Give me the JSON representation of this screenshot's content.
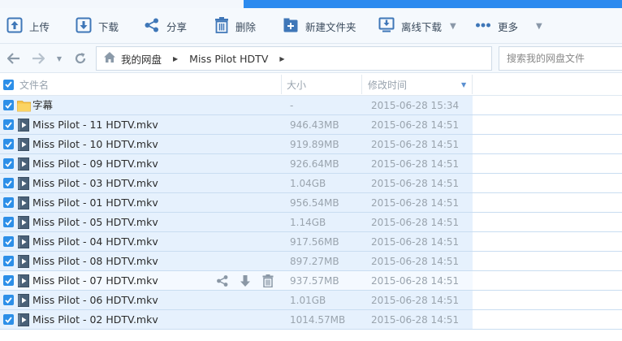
{
  "toolbar": {
    "upload": "上传",
    "download": "下载",
    "share": "分享",
    "delete": "删除",
    "new_folder": "新建文件夹",
    "offline_download": "离线下载",
    "more": "更多"
  },
  "nav": {
    "crumbs": [
      "我的网盘",
      "Miss Pilot HDTV"
    ],
    "search_placeholder": "搜索我的网盘文件"
  },
  "columns": {
    "name": "文件名",
    "size": "大小",
    "modified": "修改时间"
  },
  "files": [
    {
      "name": "字幕",
      "type": "folder",
      "size": "-",
      "date": "2015-06-28 15:34"
    },
    {
      "name": "Miss Pilot - 11 HDTV.mkv",
      "type": "video",
      "size": "946.43MB",
      "date": "2015-06-28 14:51"
    },
    {
      "name": "Miss Pilot - 10 HDTV.mkv",
      "type": "video",
      "size": "919.89MB",
      "date": "2015-06-28 14:51"
    },
    {
      "name": "Miss Pilot - 09 HDTV.mkv",
      "type": "video",
      "size": "926.64MB",
      "date": "2015-06-28 14:51"
    },
    {
      "name": "Miss Pilot - 03 HDTV.mkv",
      "type": "video",
      "size": "1.04GB",
      "date": "2015-06-28 14:51"
    },
    {
      "name": "Miss Pilot - 01 HDTV.mkv",
      "type": "video",
      "size": "956.54MB",
      "date": "2015-06-28 14:51"
    },
    {
      "name": "Miss Pilot - 05 HDTV.mkv",
      "type": "video",
      "size": "1.14GB",
      "date": "2015-06-28 14:51"
    },
    {
      "name": "Miss Pilot - 04 HDTV.mkv",
      "type": "video",
      "size": "917.56MB",
      "date": "2015-06-28 14:51"
    },
    {
      "name": "Miss Pilot - 08 HDTV.mkv",
      "type": "video",
      "size": "897.27MB",
      "date": "2015-06-28 14:51"
    },
    {
      "name": "Miss Pilot - 07 HDTV.mkv",
      "type": "video",
      "size": "937.57MB",
      "date": "2015-06-28 14:51",
      "hover": true
    },
    {
      "name": "Miss Pilot - 06 HDTV.mkv",
      "type": "video",
      "size": "1.01GB",
      "date": "2015-06-28 14:51"
    },
    {
      "name": "Miss Pilot - 02 HDTV.mkv",
      "type": "video",
      "size": "1014.57MB",
      "date": "2015-06-28 14:51"
    }
  ],
  "colors": {
    "accent": "#2c8bef",
    "selected_row": "#e6f1fd",
    "checkbox": "#2d8fe8"
  }
}
